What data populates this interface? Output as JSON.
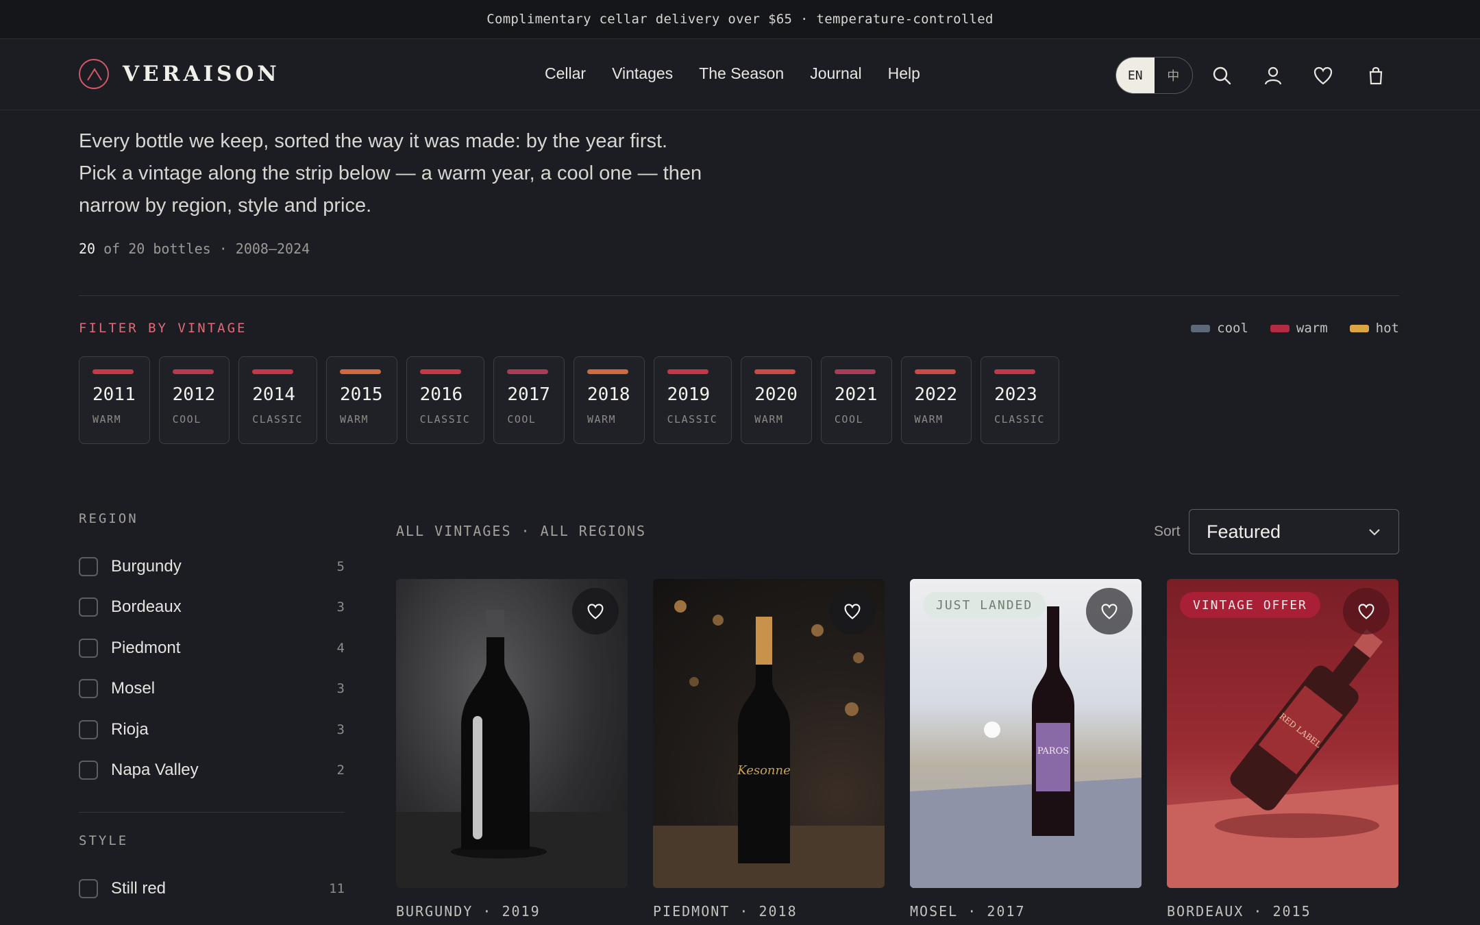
{
  "announcement": "Complimentary cellar delivery over $65 · temperature-controlled",
  "brand": {
    "name": "VERAISON",
    "accent": "#d05a68"
  },
  "nav": [
    "Cellar",
    "Vintages",
    "The Season",
    "Journal",
    "Help"
  ],
  "lang": {
    "active": "EN",
    "other": "中"
  },
  "header_icons": [
    "search-icon",
    "user-icon",
    "heart-icon",
    "bag-icon"
  ],
  "intro": {
    "line1": "Every bottle we keep, sorted the way it was made: by the year first.",
    "line2": "Pick a vintage along the strip below — a warm year, a cool one — then",
    "line3": "narrow by region, style and price."
  },
  "count": {
    "shown": "20",
    "rest": "of 20 bottles · 2008–2024"
  },
  "vintage_filter": {
    "label": "FILTER BY VINTAGE",
    "legend": [
      {
        "label": "cool",
        "color": "#5f6878"
      },
      {
        "label": "warm",
        "color": "#b32a44"
      },
      {
        "label": "hot",
        "color": "#d9a642"
      }
    ],
    "chips": [
      {
        "year": "2011",
        "kind": "WARM",
        "color": "#c63a48"
      },
      {
        "year": "2012",
        "kind": "COOL",
        "color": "#b83a4d"
      },
      {
        "year": "2014",
        "kind": "CLASSIC",
        "color": "#c33846"
      },
      {
        "year": "2015",
        "kind": "WARM",
        "color": "#cf6a40"
      },
      {
        "year": "2016",
        "kind": "CLASSIC",
        "color": "#c63a48"
      },
      {
        "year": "2017",
        "kind": "COOL",
        "color": "#a83e55"
      },
      {
        "year": "2018",
        "kind": "WARM",
        "color": "#cf6a40"
      },
      {
        "year": "2019",
        "kind": "CLASSIC",
        "color": "#c33846"
      },
      {
        "year": "2020",
        "kind": "WARM",
        "color": "#cc4a44"
      },
      {
        "year": "2021",
        "kind": "COOL",
        "color": "#a83e55"
      },
      {
        "year": "2022",
        "kind": "WARM",
        "color": "#cc4a44"
      },
      {
        "year": "2023",
        "kind": "CLASSIC",
        "color": "#c33846"
      }
    ]
  },
  "sidebar": {
    "region_title": "REGION",
    "regions": [
      {
        "name": "Burgundy",
        "count": "5"
      },
      {
        "name": "Bordeaux",
        "count": "3"
      },
      {
        "name": "Piedmont",
        "count": "4"
      },
      {
        "name": "Mosel",
        "count": "3"
      },
      {
        "name": "Rioja",
        "count": "3"
      },
      {
        "name": "Napa Valley",
        "count": "2"
      }
    ],
    "style_title": "STYLE",
    "styles": [
      {
        "name": "Still red",
        "count": "11"
      }
    ]
  },
  "listing": {
    "crumb": "ALL VINTAGES · ALL REGIONS",
    "sort_label": "Sort",
    "sort_value": "Featured"
  },
  "products": [
    {
      "meta": "BURGUNDY · 2019",
      "badge": ""
    },
    {
      "meta": "PIEDMONT · 2018",
      "badge": ""
    },
    {
      "meta": "MOSEL · 2017",
      "badge": "JUST LANDED"
    },
    {
      "meta": "BORDEAUX · 2015",
      "badge": "VINTAGE OFFER"
    }
  ],
  "bottle_labels": {
    "piedmont": "Kesonne",
    "mosel": "PAROS",
    "bordeaux": "RED LABEL"
  }
}
